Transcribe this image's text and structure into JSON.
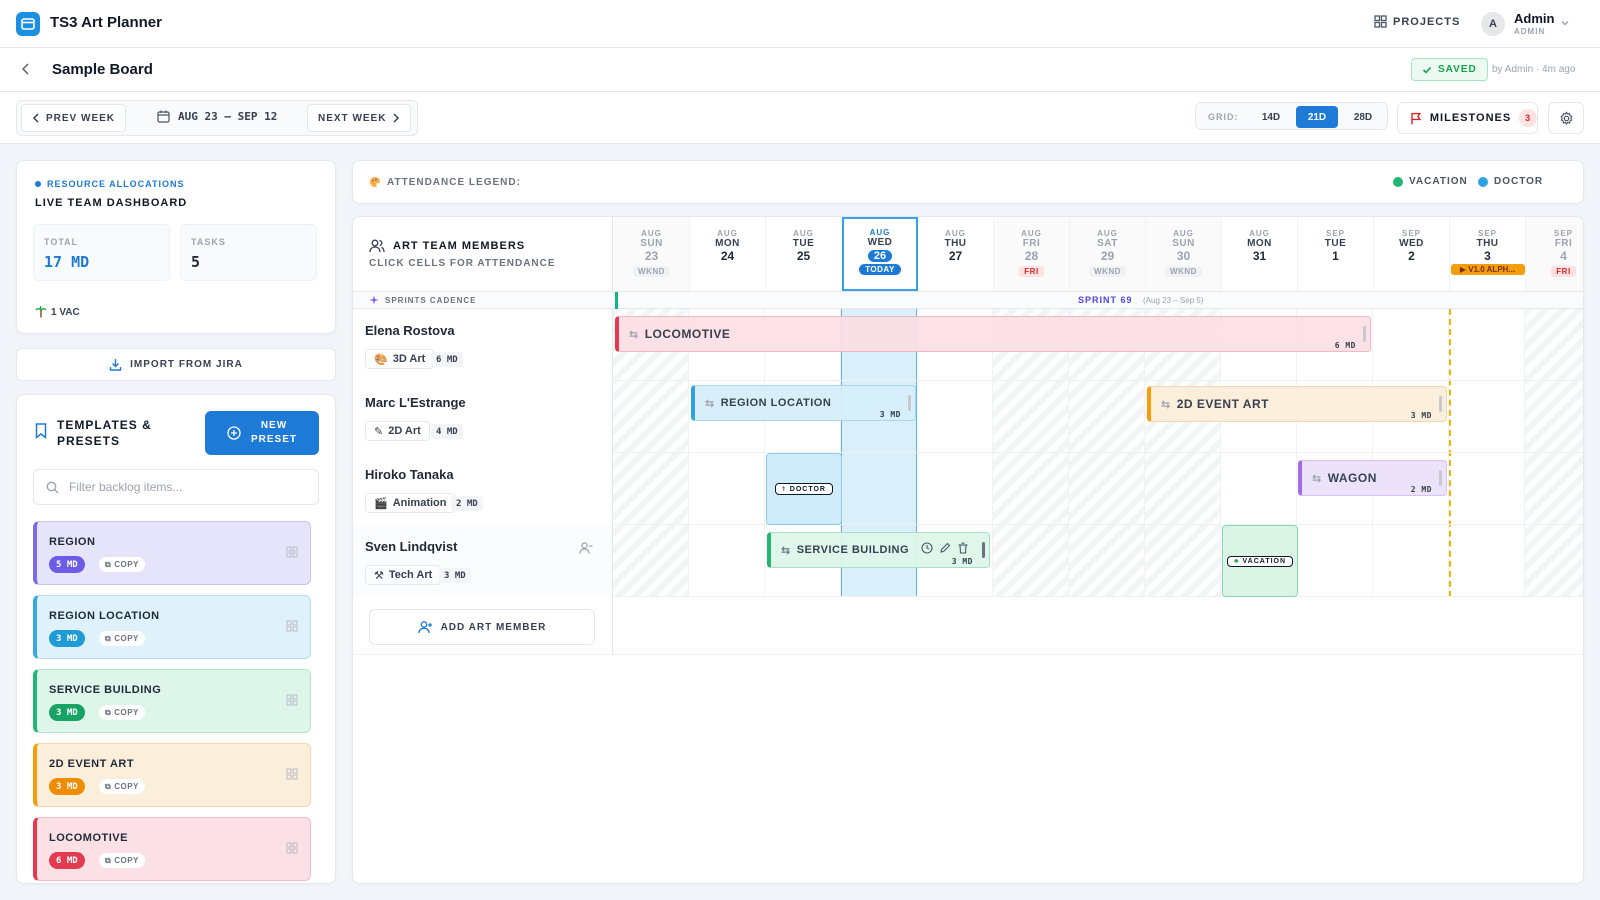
{
  "app": {
    "title": "TS3 Art Planner"
  },
  "header": {
    "projects_label": "PROJECTS",
    "avatar_initial": "A",
    "user_name": "Admin",
    "user_role": "ADMIN"
  },
  "board": {
    "title": "Sample Board",
    "saved_label": "SAVED",
    "saved_by": "by Admin · 4m ago"
  },
  "toolbar": {
    "prev_week": "PREV WEEK",
    "date_range": "AUG 23 — SEP 12",
    "next_week": "NEXT WEEK",
    "grid_label": "GRID:",
    "grid_options": [
      "14D",
      "21D",
      "28D"
    ],
    "grid_selected": "21D",
    "milestones_label": "MILESTONES",
    "milestones_count": "3"
  },
  "dashboard": {
    "kicker": "RESOURCE ALLOCATIONS",
    "title": "LIVE TEAM DASHBOARD",
    "total_label": "TOTAL",
    "total_value": "17 MD",
    "tasks_label": "TASKS",
    "tasks_value": "5",
    "vacation_summary": "1 VAC"
  },
  "import_label": "IMPORT FROM JIRA",
  "templates": {
    "title_line1": "TEMPLATES &",
    "title_line2": "PRESETS",
    "new_preset_line1": "NEW",
    "new_preset_line2": "PRESET",
    "filter_placeholder": "Filter backlog items...",
    "copy_label": "COPY",
    "items": [
      {
        "name": "REGION",
        "md": "5 MD"
      },
      {
        "name": "REGION LOCATION",
        "md": "3 MD"
      },
      {
        "name": "SERVICE BUILDING",
        "md": "3 MD"
      },
      {
        "name": "2D EVENT ART",
        "md": "3 MD"
      },
      {
        "name": "LOCOMOTIVE",
        "md": "6 MD"
      }
    ]
  },
  "legend": {
    "title": "ATTENDANCE LEGEND:",
    "items": [
      {
        "label": "VACATION",
        "color": "#22b573"
      },
      {
        "label": "DOCTOR",
        "color": "#2ea3e0"
      }
    ]
  },
  "planner": {
    "team_title": "ART TEAM MEMBERS",
    "team_subtitle": "CLICK CELLS FOR ATTENDANCE",
    "sprint_label": "SPRINTS CADENCE",
    "sprint_name": "SPRINT 69",
    "sprint_range": "(Aug 23 – Sep 5)",
    "today_label": "TODAY",
    "add_member_label": "ADD ART MEMBER",
    "days": [
      {
        "month": "AUG",
        "dow": "SUN",
        "num": "23",
        "tag": "WKND"
      },
      {
        "month": "AUG",
        "dow": "MON",
        "num": "24",
        "tag": ""
      },
      {
        "month": "AUG",
        "dow": "TUE",
        "num": "25",
        "tag": ""
      },
      {
        "month": "AUG",
        "dow": "WED",
        "num": "26",
        "tag": ""
      },
      {
        "month": "AUG",
        "dow": "THU",
        "num": "27",
        "tag": ""
      },
      {
        "month": "AUG",
        "dow": "FRI",
        "num": "28",
        "tag": "FRI"
      },
      {
        "month": "AUG",
        "dow": "SAT",
        "num": "29",
        "tag": "WKND"
      },
      {
        "month": "AUG",
        "dow": "SUN",
        "num": "30",
        "tag": "WKND"
      },
      {
        "month": "AUG",
        "dow": "MON",
        "num": "31",
        "tag": ""
      },
      {
        "month": "SEP",
        "dow": "TUE",
        "num": "1",
        "tag": ""
      },
      {
        "month": "SEP",
        "dow": "WED",
        "num": "2",
        "tag": ""
      },
      {
        "month": "SEP",
        "dow": "THU",
        "num": "3",
        "tag": ""
      },
      {
        "month": "SEP",
        "dow": "FRI",
        "num": "4",
        "tag": "FRI"
      }
    ],
    "milestone_tag": "▶ V1.0 ALPH...",
    "members": [
      {
        "name": "Elena Rostova",
        "role": "3D Art",
        "md": "6 MD"
      },
      {
        "name": "Marc L'Estrange",
        "role": "2D Art",
        "md": "4 MD"
      },
      {
        "name": "Hiroko Tanaka",
        "role": "Animation",
        "md": "2 MD"
      },
      {
        "name": "Sven Lindqvist",
        "role": "Tech Art",
        "md": "3 MD"
      }
    ],
    "tasks": [
      {
        "name": "LOCOMOTIVE",
        "md": "6 MD"
      },
      {
        "name": "REGION LOCATION",
        "md": "3 MD"
      },
      {
        "name": "2D EVENT ART",
        "md": "3 MD"
      },
      {
        "name": "WAGON",
        "md": "2 MD"
      },
      {
        "name": "SERVICE BUILDING",
        "md": "3 MD"
      }
    ],
    "absences": [
      {
        "label": "DOCTOR"
      },
      {
        "label": "VACATION"
      }
    ]
  }
}
